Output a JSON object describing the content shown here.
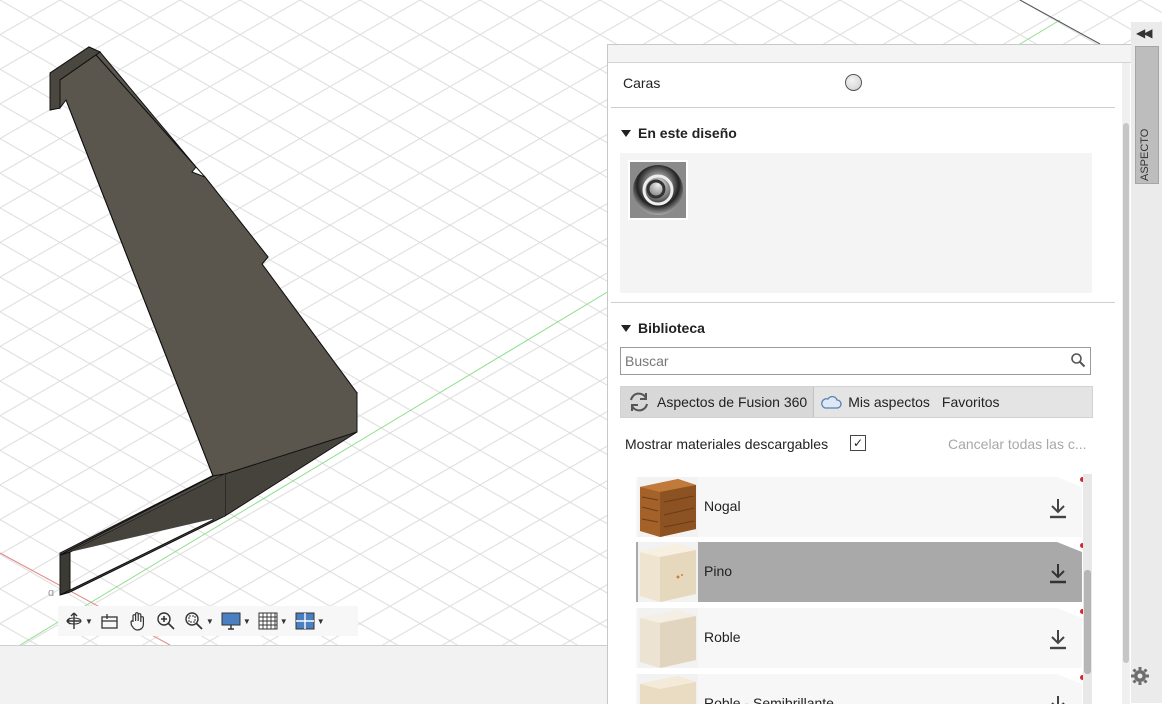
{
  "viewport": {
    "toolbar": [
      {
        "icon": "orbit-icon",
        "dropdown": true
      },
      {
        "icon": "look-at-icon",
        "dropdown": false
      },
      {
        "icon": "pan-hand-icon",
        "dropdown": false
      },
      {
        "icon": "zoom-icon",
        "dropdown": false
      },
      {
        "icon": "fit-zoom-icon",
        "dropdown": true
      },
      {
        "icon": "display-settings-icon",
        "dropdown": true
      },
      {
        "icon": "grid-settings-icon",
        "dropdown": true
      },
      {
        "icon": "viewports-icon",
        "dropdown": true
      }
    ]
  },
  "panel": {
    "apply_to": {
      "label": "Caras"
    },
    "in_design": {
      "title": "En este diseño",
      "items": [
        {
          "icon": "chrome-material-icon"
        }
      ]
    },
    "library": {
      "title": "Biblioteca",
      "search_placeholder": "Buscar",
      "tabs": [
        {
          "label": "Aspectos de Fusion 360",
          "icon": "refresh-icon"
        },
        {
          "label": "Mis aspectos",
          "icon": "cloud-icon"
        },
        {
          "label": "Favoritos"
        }
      ],
      "show_downloadable_label": "Mostrar materiales descargables",
      "show_downloadable_checked": "✓",
      "cancel_all": "Cancelar todas las c...",
      "materials": [
        {
          "name": "Nogal",
          "selected": false
        },
        {
          "name": "Pino",
          "selected": true
        },
        {
          "name": "Roble",
          "selected": false
        },
        {
          "name": "Roble - Semibrillante",
          "selected": false
        }
      ]
    }
  },
  "side": {
    "tab_label": "ASPECTO",
    "collapse": "◀◀"
  },
  "colors": {
    "part_fill": "#5a564e",
    "grid_line": "#d9d9d9",
    "axis_green": "#7be07b",
    "axis_red": "#e06a6a",
    "selected_row": "#a9a9a9"
  }
}
